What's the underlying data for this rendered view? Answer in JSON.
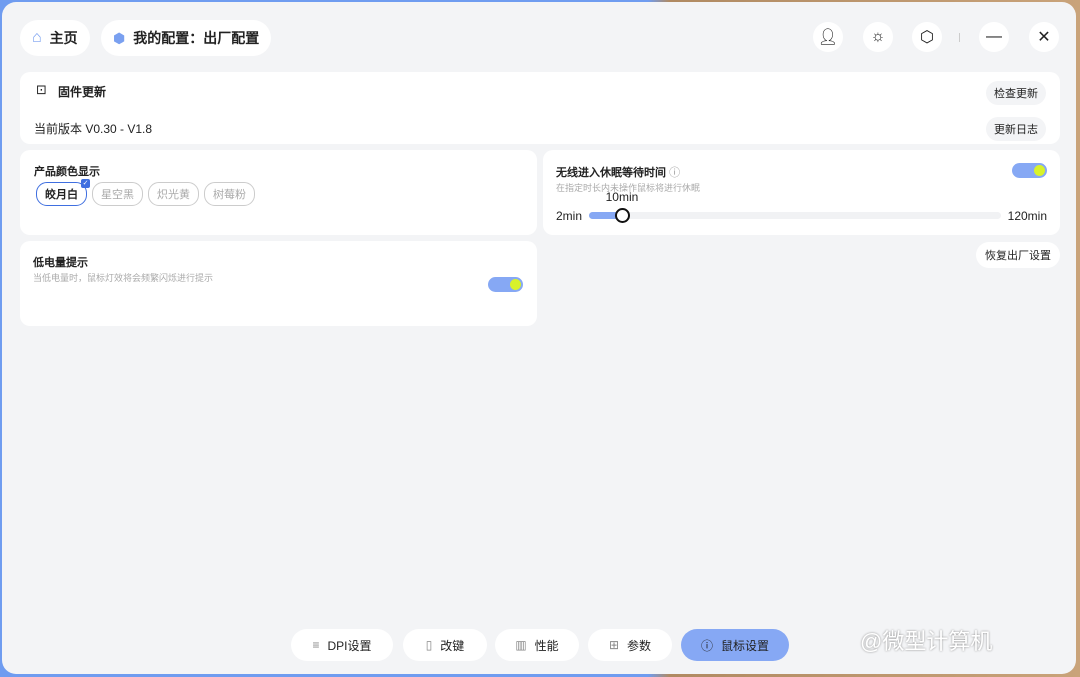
{
  "header": {
    "home": "主页",
    "config": "我的配置：出厂配置"
  },
  "firmware": {
    "title": "固件更新",
    "version": "当前版本 V0.30 - V1.8",
    "check": "检查更新",
    "log": "更新日志"
  },
  "color": {
    "title": "产品颜色显示",
    "options": [
      "皎月白",
      "星空黑",
      "炽光黄",
      "树莓粉"
    ],
    "selected": 0
  },
  "sleep": {
    "title": "无线进入休眠等待时间",
    "desc": "在指定时长内未操作鼠标将进行休眠",
    "min": "2min",
    "max": "120min",
    "value_label": "10min",
    "min_value": 2,
    "max_value": 120,
    "value": 10,
    "enabled": true
  },
  "battery": {
    "title": "低电量提示",
    "desc": "当低电量时，鼠标灯效将会频繁闪烁进行提示",
    "enabled": true
  },
  "reset": "恢复出厂设置",
  "nav": [
    "DPI设置",
    "改键",
    "性能",
    "参数",
    "鼠标设置"
  ],
  "watermark": "@微型计算机",
  "colors": {
    "accent": "#86a8f4",
    "knob": "#d8f22a"
  }
}
